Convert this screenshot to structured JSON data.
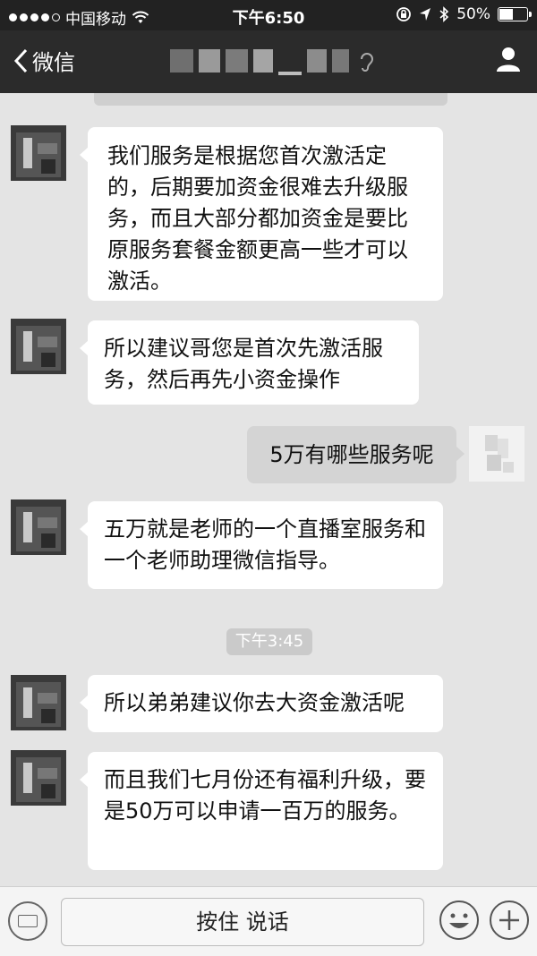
{
  "status_bar": {
    "carrier": "中国移动",
    "time": "下午6:50",
    "battery": "50%",
    "battery_level": 0.5
  },
  "nav": {
    "back_label": "微信"
  },
  "messages": [
    {
      "from": "contact",
      "text": "我们服务是根据您首次激活定的，后期要加资金很难去升级服务，而且大部分都加资金是要比原服务套餐金额更高一些才可以激活。"
    },
    {
      "from": "contact",
      "text": "所以建议哥您是首次先激活服务，然后再先小资金操作"
    },
    {
      "from": "me",
      "text": "5万有哪些服务呢"
    },
    {
      "from": "contact",
      "text": "五万就是老师的一个直播室服务和一个老师助理微信指导。"
    },
    {
      "from": "contact",
      "text": "所以弟弟建议你去大资金激活呢"
    },
    {
      "from": "contact",
      "text": "而且我们七月份还有福利升级，要是50万可以申请一百万的服务。"
    }
  ],
  "timestamp": "下午3:45",
  "input_bar": {
    "hold_to_talk": "按住 说话"
  },
  "icons": {
    "back": "chevron-left-icon",
    "profile": "person-icon",
    "voice_mode": "ear-icon",
    "keyboard": "keyboard-icon",
    "emoji": "emoji-icon",
    "more": "plus-icon"
  },
  "colors": {
    "nav_bg": "#2b2b2b",
    "chat_bg": "#e4e4e4",
    "incoming_bubble": "#ffffff",
    "outgoing_bubble": "#d4d4d4"
  }
}
